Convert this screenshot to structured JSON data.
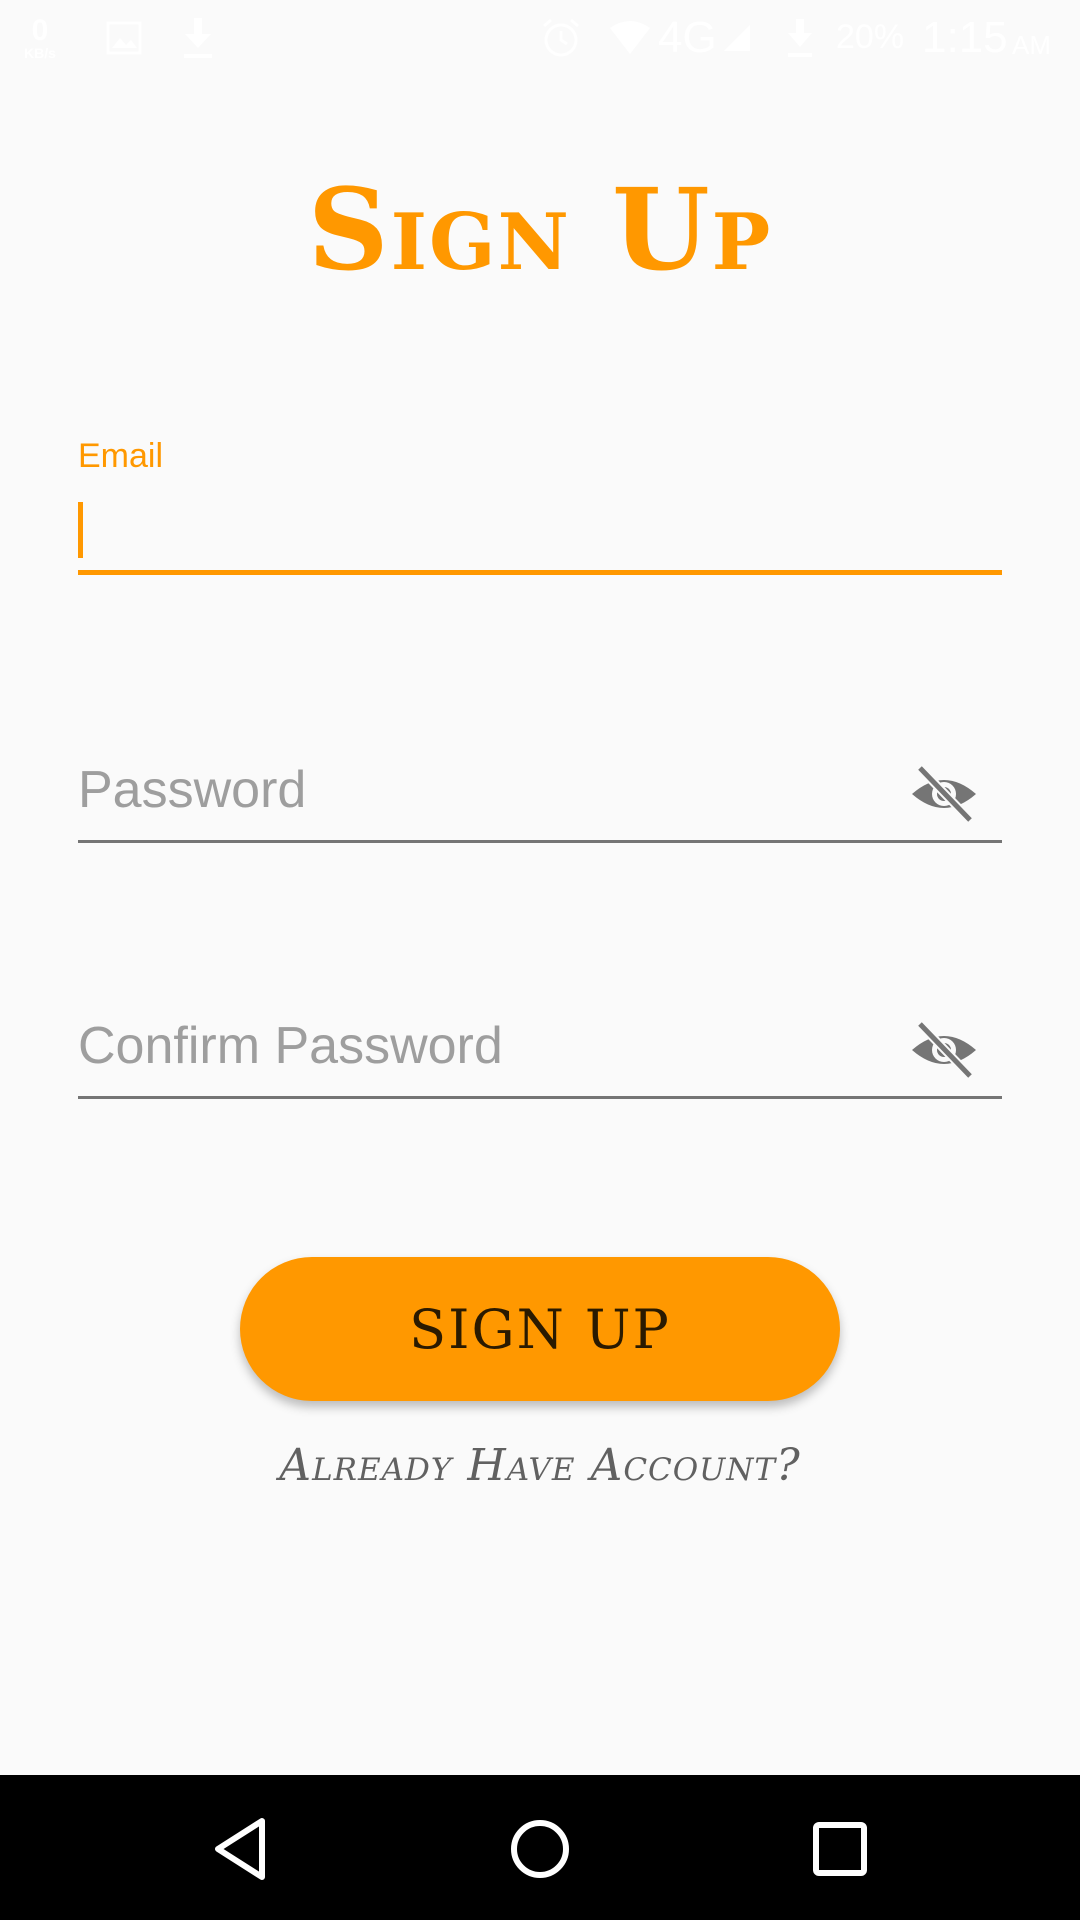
{
  "status_bar": {
    "speed_value": "0",
    "speed_unit": "KB/s",
    "network": "4G",
    "battery": "20%",
    "time": "1:15",
    "ampm": "AM"
  },
  "title": "Sign Up",
  "email": {
    "label": "Email",
    "value": ""
  },
  "password": {
    "placeholder": "Password"
  },
  "confirm_password": {
    "placeholder": "Confirm Password"
  },
  "signup_button": "SIGN UP",
  "already_link": "Already Have Account?",
  "colors": {
    "accent": "#ff9800",
    "underline": "#757575",
    "placeholder": "#9e9e9e",
    "background": "#fafafa"
  },
  "icons": {
    "visibility_toggle": "visibility-off-icon",
    "nav_back": "back-triangle-icon",
    "nav_home": "home-circle-icon",
    "nav_recent": "recent-apps-square-icon"
  }
}
